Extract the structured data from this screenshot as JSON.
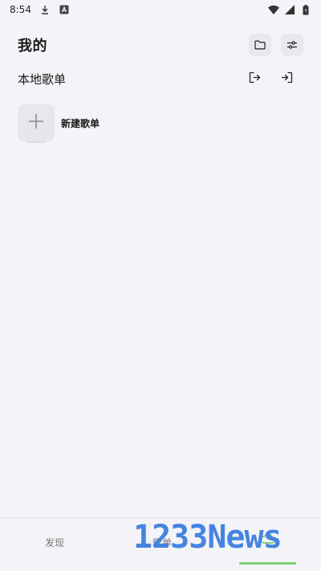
{
  "status_bar": {
    "time": "8:54",
    "icons": [
      "download-icon",
      "a-badge-icon",
      "wifi-icon",
      "signal-icon",
      "battery-icon"
    ]
  },
  "header": {
    "title": "我的",
    "actions": [
      "folder-icon",
      "sliders-icon"
    ]
  },
  "local_playlists": {
    "title": "本地歌单",
    "actions": [
      "export-icon",
      "import-icon"
    ]
  },
  "new_playlist": {
    "label": "新建歌单"
  },
  "bottom_nav": {
    "items": [
      {
        "label": "发现"
      },
      {
        "label": "歌单"
      }
    ],
    "active_color": "#7ccf72"
  },
  "watermark": {
    "text": "1233News"
  }
}
